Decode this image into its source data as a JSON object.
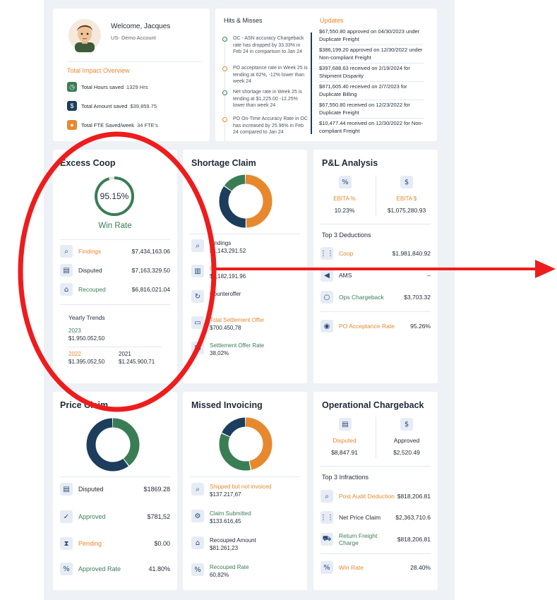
{
  "welcome": {
    "greeting": "Welcome, Jacques",
    "account": "US- Demo Account",
    "impact_title": "Total Impact Overview",
    "metrics": [
      {
        "label": "Total Hours saved",
        "value": "1329 Hrs"
      },
      {
        "label": "Total Amount saved",
        "value": "$39,859.75"
      },
      {
        "label": "Total FTE Saved/week",
        "value": "34 FTE's"
      }
    ]
  },
  "hits": {
    "title": "Hits & Misses",
    "items": [
      "OC - ASN accuracy Chargeback rate has dropped by 33.33% in Feb 24 in comparison to Jan 24",
      "PO acceptance rate in Week 25 is tending at 62%, -12% lower than week 24",
      "Net shortage rate in Week 25 is tending at $1,225.00 -12.25% lower than week 24",
      "PO On-Time Accuracy Rate in OC has increased by 25.96% in Feb 24 compared to Jan 24"
    ]
  },
  "updates": {
    "title": "Updates",
    "items": [
      "$67,550.80 approved on 04/30/2023 under Duplicate Freight",
      "$386,199.20 approved on 12/30/2022 under Non-compliant Freight",
      "$397,688.63 received on 2/19/2024 for Shipment Disparity",
      "$871,605.40 received on 2/7/2023 for Duplicate Billing",
      "$67,550.80 received on 12/23/2022 for Duplicate Freight",
      "$10,477.44 received on 12/30/2022 for Non-compliant Freight"
    ]
  },
  "excess": {
    "title": "Excess Coop",
    "percent": "95.15%",
    "percent_value": 95.15,
    "win_label": "Win Rate",
    "rows": [
      {
        "label": "Findings",
        "value": "$7,434,163.06"
      },
      {
        "label": "Disputed",
        "value": "$7,163,329.50"
      },
      {
        "label": "Recouped",
        "value": "$6,816,021.04"
      }
    ],
    "trends_title": "Yearly Trends",
    "trends": [
      {
        "year": "2023",
        "value": "$1.950.052,50"
      },
      {
        "year": "2022",
        "value": "$1.395.052,50"
      },
      {
        "year": "2021",
        "value": "$1.245.900,71"
      }
    ]
  },
  "shortage": {
    "title": "Shortage Claim",
    "rows": [
      {
        "label": "Findings",
        "value": "$1,143,291.52"
      },
      {
        "label": "Ou",
        "value": "$1,182,191.96"
      },
      {
        "label": "Counteroffer",
        "value": "$"
      },
      {
        "label": "Total Settlement Offer",
        "value": "$700.450,78"
      },
      {
        "label": "Settlement Offer Rate",
        "value": "38,02%"
      }
    ]
  },
  "pl": {
    "title": "P&L Analysis",
    "ebita_pct_label": "EBITA %",
    "ebita_pct_value": "10.23%",
    "ebita_usd_label": "EBITA $",
    "ebita_usd_value": "$1,075,280.93",
    "deductions_title": "Top 3 Deductions",
    "rows": [
      {
        "label": "Coop",
        "value": "$1,981,840.92"
      },
      {
        "label": "AMS",
        "value": "–"
      },
      {
        "label": "Ops Chargeback",
        "value": "$3,703.32"
      }
    ],
    "po_label": "PO Acceptance Rate",
    "po_value": "95.26%"
  },
  "price": {
    "title": "Price Claim",
    "rows": [
      {
        "label": "Disputed",
        "value": "$1869.28"
      },
      {
        "label": "Approved",
        "value": "$781,52"
      },
      {
        "label": "Pending",
        "value": "$0.00"
      },
      {
        "label": "Approved Rate",
        "value": "41.80%"
      }
    ]
  },
  "missed": {
    "title": "Missed Invoicing",
    "rows": [
      {
        "label": "Shipped but not invoiced",
        "value": "$137.217,67"
      },
      {
        "label": "Claim Submitted",
        "value": "$133.616,45"
      },
      {
        "label": "Recouped Amount",
        "value": "$81.261,23"
      },
      {
        "label": "Recouped Rate",
        "value": "60,82%"
      }
    ]
  },
  "ops": {
    "title": "Operational Chargeback",
    "disputed_label": "Disputed",
    "disputed_value": "$8,847.91",
    "approved_label": "Approved",
    "approved_value": "$2,520.49",
    "infractions_title": "Top 3 Infractions",
    "rows": [
      {
        "label": "Post Audit Deduction",
        "value": "$818,206.81"
      },
      {
        "label": "Net Price Claim",
        "value": "$2,363,710.6"
      },
      {
        "label": "Return Freight Charge",
        "value": "$818,206.81"
      }
    ],
    "win_label": "Win Rate",
    "win_value": "28.40%"
  },
  "colors": {
    "orange": "#e8882e",
    "green": "#3a7d55",
    "navy": "#1c3d5c",
    "annotation_red": "#ee1c1c"
  },
  "donuts": {
    "shortage": [
      {
        "value": 50,
        "color": "#e8882e"
      },
      {
        "value": 35,
        "color": "#1c3d5c"
      },
      {
        "value": 15,
        "color": "#3a7d55"
      }
    ],
    "price": [
      {
        "value": 40,
        "color": "#3a7d55"
      },
      {
        "value": 60,
        "color": "#1c3d5c"
      }
    ],
    "missed": [
      {
        "value": 47,
        "color": "#e8882e"
      },
      {
        "value": 35,
        "color": "#3a7d55"
      },
      {
        "value": 18,
        "color": "#1c3d5c"
      }
    ]
  }
}
